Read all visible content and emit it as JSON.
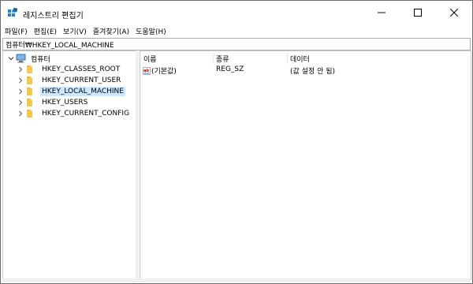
{
  "window": {
    "title": "레지스트리 편집기",
    "controls": {
      "minimize": "minimize",
      "maximize": "maximize",
      "close": "close"
    }
  },
  "menu": [
    {
      "label": "파일(F)"
    },
    {
      "label": "편집(E)"
    },
    {
      "label": "보기(V)"
    },
    {
      "label": "즐겨찾기(A)"
    },
    {
      "label": "도움말(H)"
    }
  ],
  "address": {
    "path": "컴퓨터₩HKEY_LOCAL_MACHINE"
  },
  "tree": {
    "root": {
      "label": "컴퓨터",
      "expanded": true,
      "icon": "computer-icon"
    },
    "children": [
      {
        "label": "HKEY_CLASSES_ROOT",
        "icon": "folder-icon",
        "selected": false
      },
      {
        "label": "HKEY_CURRENT_USER",
        "icon": "folder-icon",
        "selected": false
      },
      {
        "label": "HKEY_LOCAL_MACHINE",
        "icon": "folder-icon",
        "selected": true
      },
      {
        "label": "HKEY_USERS",
        "icon": "folder-icon",
        "selected": false
      },
      {
        "label": "HKEY_CURRENT_CONFIG",
        "icon": "folder-icon",
        "selected": false
      }
    ]
  },
  "list": {
    "columns": [
      "이름",
      "종류",
      "데이터"
    ],
    "rows": [
      {
        "name": "(기본값)",
        "type": "REG_SZ",
        "data": "(값 설정 안 됨)",
        "icon": "string-value-icon"
      }
    ]
  },
  "colors": {
    "selection": "#cce8ff",
    "folder": "#e8b740",
    "accent": "#0067c0"
  }
}
